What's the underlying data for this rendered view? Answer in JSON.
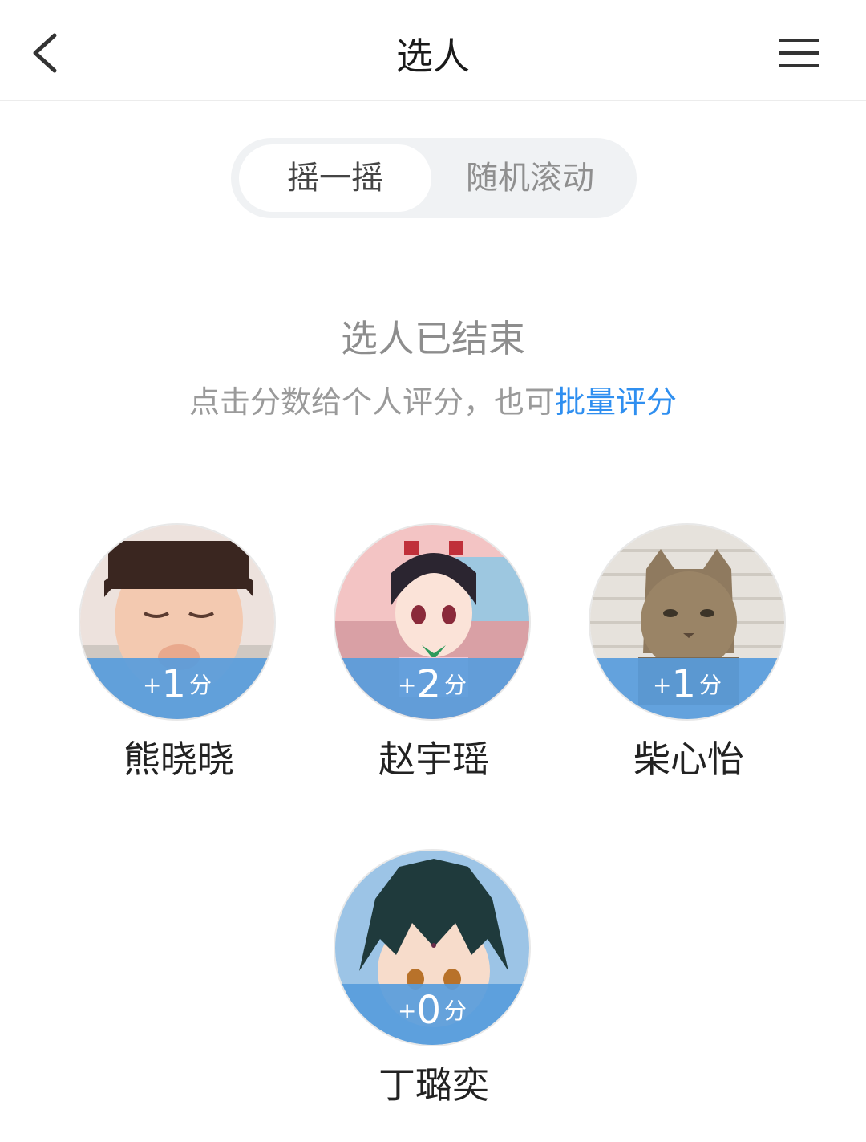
{
  "nav": {
    "title": "选人",
    "back_icon": "chevron-left-icon",
    "menu_icon": "hamburger-menu-icon"
  },
  "mode_tabs": {
    "active": "摇一摇",
    "inactive": "随机滚动"
  },
  "status": {
    "title": "选人已结束",
    "hint_prefix": "点击分数给个人评分，也可",
    "hint_link": "批量评分"
  },
  "people": [
    {
      "name": "熊晓晓",
      "plus": "+",
      "score": "1",
      "unit": "分"
    },
    {
      "name": "赵宇瑶",
      "plus": "+",
      "score": "2",
      "unit": "分"
    },
    {
      "name": "柴心怡",
      "plus": "+",
      "score": "1",
      "unit": "分"
    },
    {
      "name": "丁璐奕",
      "plus": "+",
      "score": "0",
      "unit": "分"
    }
  ],
  "colors": {
    "link": "#2f8ff0",
    "score_band": "#589cdc",
    "tab_track": "#f0f2f4"
  }
}
